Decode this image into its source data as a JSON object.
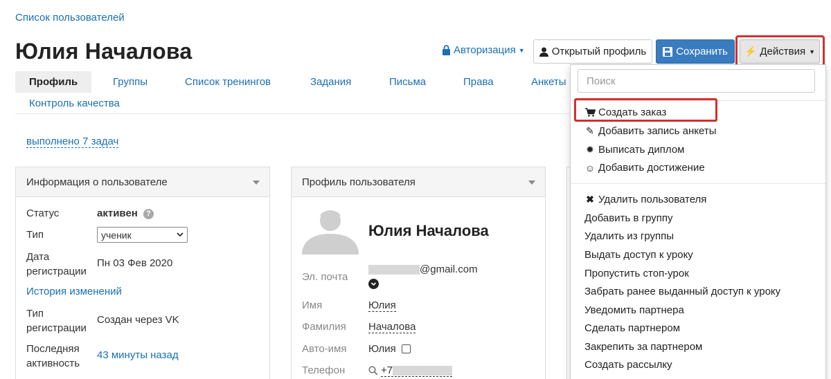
{
  "breadcrumb": "Список пользователей",
  "page_title": "Юлия Началова",
  "header": {
    "auth_label": "Авторизация",
    "open_profile_label": "Открытый профиль",
    "save_label": "Сохранить",
    "actions_label": "Действия"
  },
  "tabs": [
    "Профиль",
    "Группы",
    "Список тренингов",
    "Задания",
    "Письма",
    "Права",
    "Анкеты",
    "Контроль качества"
  ],
  "tasks_link": "выполнено 7 задач",
  "user_info": {
    "title": "Информация о пользователе",
    "status_label": "Статус",
    "status_value": "активен",
    "type_label": "Тип",
    "type_value": "ученик",
    "reg_date_label_1": "Дата",
    "reg_date_label_2": "регистрации",
    "reg_date_value": "Пн 03 Фев 2020",
    "history_link": "История изменений",
    "reg_type_label_1": "Тип",
    "reg_type_label_2": "регистрации",
    "reg_type_value": "Создан через VK",
    "last_activity_label_1": "Последняя",
    "last_activity_label_2": "активность",
    "last_activity_value": "43 минуты назад"
  },
  "profile": {
    "title": "Профиль пользователя",
    "name": "Юлия Началова",
    "email_label": "Эл. почта",
    "email_value": "@gmail.com",
    "first_name_label": "Имя",
    "first_name_value": "Юлия",
    "last_name_label": "Фамилия",
    "last_name_value": "Началова",
    "auto_name_label": "Авто-имя",
    "auto_name_value": "Юлия",
    "phone_label": "Телефон",
    "phone_value": "+7"
  },
  "actions_menu": {
    "search_placeholder": "Поиск",
    "group1": [
      "Создать заказ",
      "Добавить запись анкеты",
      "Выписать диплом",
      "Добавить достижение"
    ],
    "group2": [
      "Удалить пользователя",
      "Добавить в группу",
      "Удалить из группы",
      "Выдать доступ к уроку",
      "Пропустить стоп-урок",
      "Забрать ранее выданный доступ к уроку",
      "Уведомить партнера",
      "Сделать партнером",
      "Закрепить за партнером",
      "Создать рассылку"
    ]
  },
  "colors": {
    "link": "#1a6fb5",
    "primary_button": "#3a7cc0",
    "highlight": "#d32f2f"
  }
}
